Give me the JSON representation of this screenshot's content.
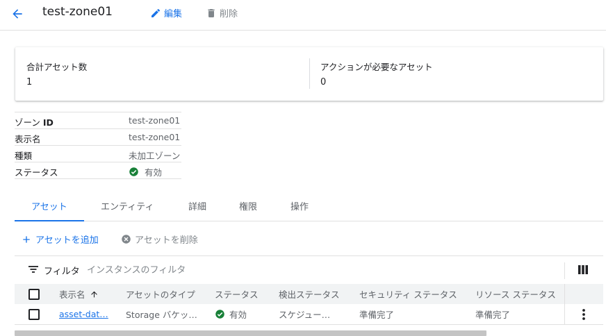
{
  "header": {
    "title": "test-zone01",
    "edit_label": "編集",
    "delete_label": "削除"
  },
  "summary": {
    "total_assets_label": "合計アセット数",
    "total_assets_value": "1",
    "action_required_label": "アクションが必要なアセット",
    "action_required_value": "0"
  },
  "properties": {
    "zone_id_label_prefix": "ゾーン",
    "zone_id_label_bold": "ID",
    "zone_id_value": "test-zone01",
    "display_name_label": "表示名",
    "display_name_value": "test-zone01",
    "type_label": "種類",
    "type_value": "未加工ゾーン",
    "status_label": "ステータス",
    "status_value": "有効"
  },
  "tabs": [
    "アセット",
    "エンティティ",
    "詳細",
    "権限",
    "操作"
  ],
  "asset_actions": {
    "add_label": "アセットを追加",
    "delete_label": "アセットを削除"
  },
  "filter": {
    "label": "フィルタ",
    "placeholder": "インスタンスのフィルタ"
  },
  "table": {
    "columns": [
      "表示名",
      "アセットのタイプ",
      "ステータス",
      "検出ステータス",
      "セキュリティ ステータス",
      "リソース ステータス"
    ],
    "rows": [
      {
        "display_name": "asset-dat…",
        "asset_type": "Storage バケッ…",
        "status": "有効",
        "discovery_status": "スケジュー…",
        "security_status": "準備完了",
        "resource_status": "準備完了"
      }
    ]
  },
  "colors": {
    "accent": "#1a73e8",
    "success": "#188038",
    "muted": "#80868b"
  }
}
